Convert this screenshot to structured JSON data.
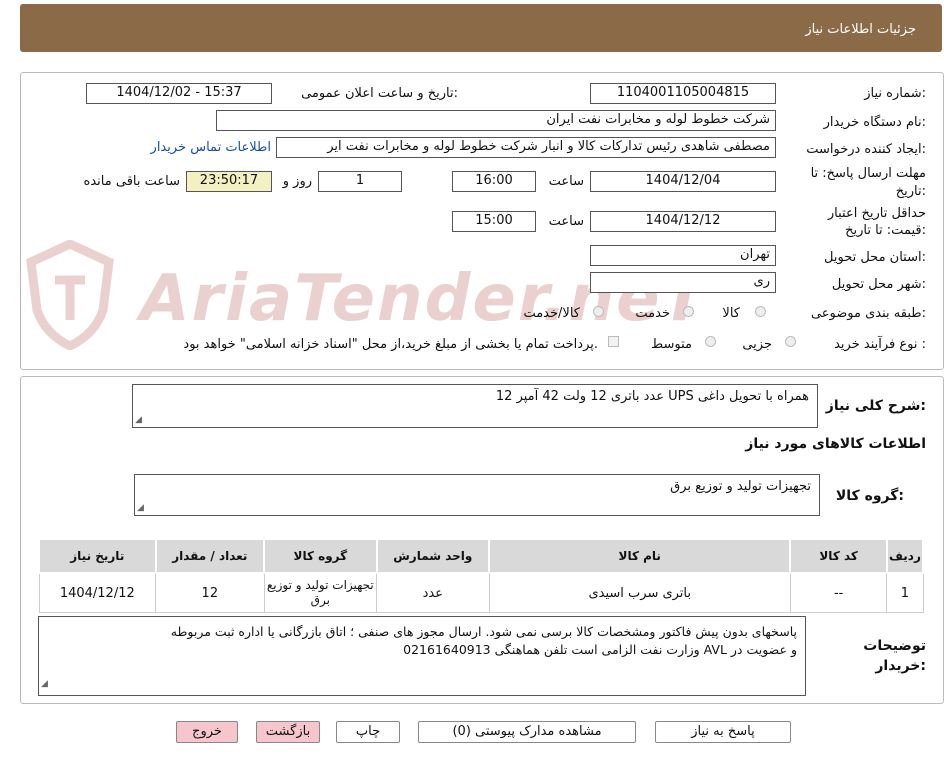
{
  "header": {
    "title": "جزئیات اطلاعات نیاز"
  },
  "watermark": "AriaTender.neT",
  "form": {
    "need_number_label": "شماره نیاز:",
    "need_number": "1104001105004815",
    "announce_label": "تاریخ و ساعت اعلان عمومی:",
    "announce_value": "1404/12/02 - 15:37",
    "buyer_org_label": "نام دستگاه خریدار:",
    "buyer_org": "شرکت خطوط لوله و مخابرات نفت ایران",
    "requester_label": "ایجاد کننده درخواست:",
    "requester": "مصطفی  شاهدی رئیس تدارکات کالا و انبار شرکت خطوط لوله و مخابرات نفت ایر",
    "contact_link": "اطلاعات تماس خریدار",
    "deadline_label_1": "مهلت ارسال پاسخ: تا",
    "deadline_label_2": "تاریخ:",
    "deadline_date": "1404/12/04",
    "time_label": "ساعت",
    "deadline_time": "16:00",
    "days_value": "1",
    "days_label": "روز و",
    "remaining_time": "23:50:17",
    "remaining_label": "ساعت باقی مانده",
    "validity_label_1": "حداقل تاریخ اعتبار",
    "validity_label_2": "قیمت: تا تاریخ:",
    "validity_date": "1404/12/12",
    "validity_time": "15:00",
    "province_label": "استان محل تحویل:",
    "province": "تهران",
    "city_label": "شهر محل تحویل:",
    "city": "ری",
    "category_label": "طبقه بندی موضوعی:",
    "category_options": [
      "کالا",
      "خدمت",
      "کالا/خدمت"
    ],
    "process_label": "نوع فرآیند خرید :",
    "process_options": [
      "جزیی",
      "متوسط"
    ],
    "payment_note": "پرداخت تمام یا بخشی از مبلغ خرید،از محل \"اسناد خزانه اسلامی\" خواهد بود."
  },
  "summary": {
    "label": "شرح کلی نیاز:",
    "text": "12 عدد باتری 12 ولت   42 آمپر  UPS  همراه با تحویل داغی"
  },
  "goods": {
    "section_title": "اطلاعات کالاهای مورد نیاز",
    "group_label": "گروه کالا:",
    "group_value": "تجهیزات تولید و توزیع برق",
    "columns": [
      "ردیف",
      "کد کالا",
      "نام کالا",
      "واحد شمارش",
      "گروه کالا",
      "تعداد / مقدار",
      "تاریخ نیاز"
    ],
    "rows": [
      [
        "1",
        "--",
        "باتری سرب اسیدی",
        "عدد",
        "تجهیزات تولید و توزیع برق",
        "12",
        "1404/12/12"
      ]
    ]
  },
  "buyer_notes": {
    "label_1": "توضیحات",
    "label_2": "خریدار:",
    "line_1": "پاسخهای بدون پیش فاکتور ومشخصات کالا برسی نمی شود. ارسال مجوز های صنفی ؛ اتاق بازرگانی یا اداره ثبت  مربوطه",
    "line_2": "و عضویت در AVL وزارت نفت الزامی است تلفن هماهنگی  02161640913"
  },
  "buttons": {
    "reply": "پاسخ به نیاز",
    "attachments": "مشاهده مدارک پیوستی (0)",
    "print": "چاپ",
    "back": "بازگشت",
    "exit": "خروج"
  },
  "colors": {
    "header_bg": "#8b6a48",
    "timer_bg": "#f3f0c2",
    "table_header_bg": "#d9d9d9",
    "pink_button": "#f6c6cc",
    "link": "#1a4ea8"
  }
}
